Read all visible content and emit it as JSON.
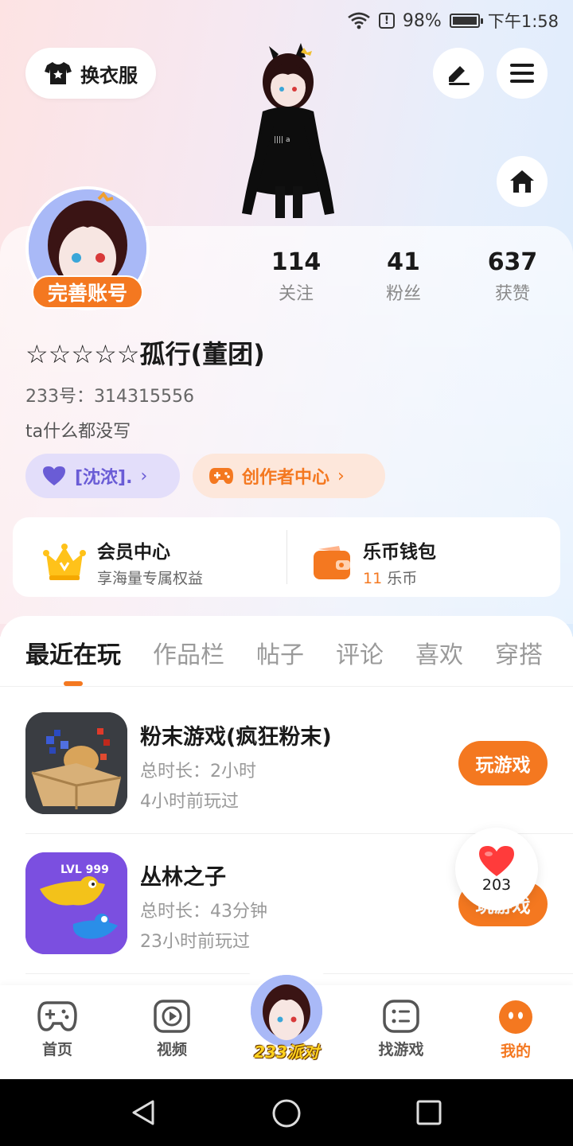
{
  "status_bar": {
    "battery": "98%",
    "time": "下午1:58"
  },
  "top": {
    "outfit_label": "换衣服"
  },
  "profile": {
    "complete_label": "完善账号",
    "stats": [
      {
        "value": "114",
        "label": "关注"
      },
      {
        "value": "41",
        "label": "粉丝"
      },
      {
        "value": "637",
        "label": "获赞"
      }
    ],
    "nickname": "☆☆☆☆☆孤行(董团)",
    "id_line": "233号：314315556",
    "bio": "ta什么都没写",
    "chip_group": "[沈浓].",
    "chip_creator": "创作者中心"
  },
  "panel": {
    "vip_title": "会员中心",
    "vip_sub": "享海量专属权益",
    "wallet_title": "乐币钱包",
    "wallet_amount": "11",
    "wallet_unit": "乐币"
  },
  "tabs": [
    "最近在玩",
    "作品栏",
    "帖子",
    "评论",
    "喜欢",
    "穿搭"
  ],
  "games": [
    {
      "name": "粉末游戏(疯狂粉末)",
      "duration": "总时长：2小时",
      "last": "4小时前玩过",
      "button": "玩游戏"
    },
    {
      "name": "丛林之子",
      "duration": "总时长：43分钟",
      "last": "23小时前玩过",
      "button": "玩游戏",
      "icon_text": "LVL 999"
    }
  ],
  "like_count": "203",
  "nav": {
    "home": "首页",
    "video": "视频",
    "party": "233派对",
    "find": "找游戏",
    "mine": "我的"
  },
  "colors": {
    "accent": "#f47820",
    "purple": "#6a5cd6",
    "chip_purple_bg": "#e3defa",
    "chip_orange_bg": "#fde7db"
  }
}
